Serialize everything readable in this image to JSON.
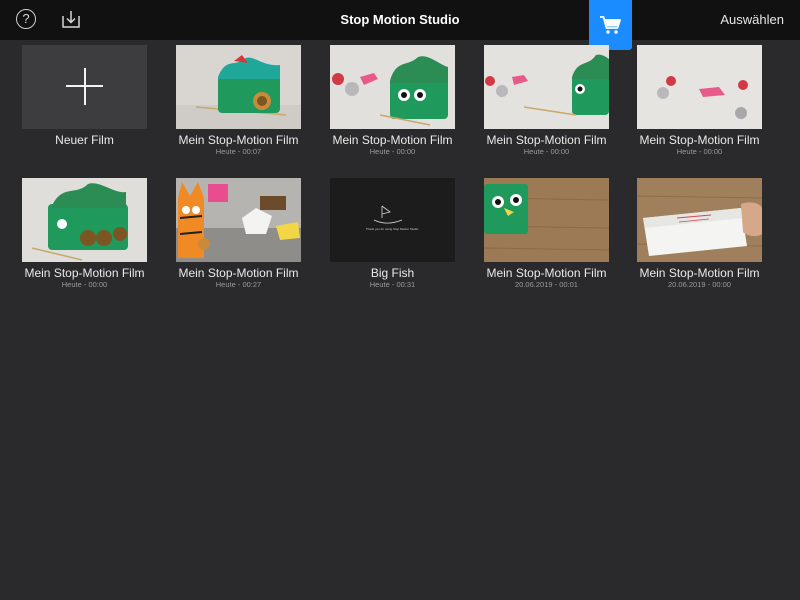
{
  "app": {
    "title": "Stop Motion Studio",
    "select_label": "Auswählen",
    "help_glyph": "?"
  },
  "icons": {
    "help": "help-circle-icon",
    "import": "import-download-icon",
    "store": "shopping-cart-icon"
  },
  "colors": {
    "accent": "#1a8cff",
    "topbar": "#111112",
    "background": "#2a2a2c"
  },
  "new_film": {
    "label": "Neuer Film"
  },
  "projects": [
    {
      "title": "Mein Stop-Motion Film",
      "subtitle": "Heute - 00:07",
      "thumb": "green-box-teal-paper"
    },
    {
      "title": "Mein Stop-Motion Film",
      "subtitle": "Heute - 00:00",
      "thumb": "green-box-eyes-paper-balls"
    },
    {
      "title": "Mein Stop-Motion Film",
      "subtitle": "Heute - 00:00",
      "thumb": "paper-balls-green-box-right"
    },
    {
      "title": "Mein Stop-Motion Film",
      "subtitle": "Heute - 00:00",
      "thumb": "paper-balls-only"
    },
    {
      "title": "Mein Stop-Motion Film",
      "subtitle": "Heute - 00:00",
      "thumb": "green-box-wheels"
    },
    {
      "title": "Mein Stop-Motion Film",
      "subtitle": "Heute - 00:27",
      "thumb": "orange-tiger-paper"
    },
    {
      "title": "Big Fish",
      "subtitle": "Heute - 00:31",
      "thumb": "dark-end-card",
      "thumb_caption": "Thank you for using Stop Motion Studio."
    },
    {
      "title": "Mein Stop-Motion Film",
      "subtitle": "20.06.2019 - 00:01",
      "thumb": "green-box-on-wood"
    },
    {
      "title": "Mein Stop-Motion Film",
      "subtitle": "20.06.2019 - 00:00",
      "thumb": "white-card-on-wood"
    }
  ]
}
